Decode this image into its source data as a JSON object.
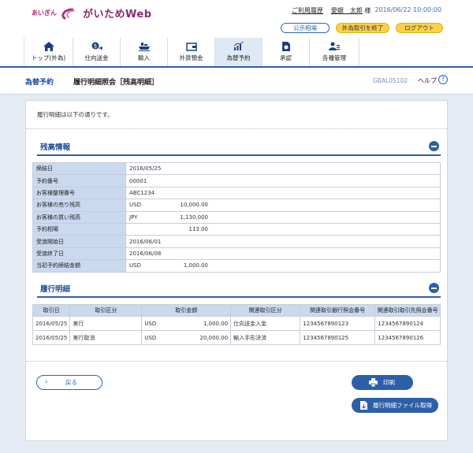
{
  "header": {
    "logo_small": "あいぎん",
    "logo_main": "がいためWeb",
    "history_link": "ご利用履歴",
    "user_name": "愛銀　太郎",
    "user_suffix": "様",
    "timestamp": "2016/06/22 10:00:00",
    "rates_button": "公示相場",
    "exit_fx_button": "外為取引を終了",
    "logout_button": "ログアウト"
  },
  "nav": [
    {
      "label": "トップ(外為)",
      "icon": "home-icon"
    },
    {
      "label": "仕向送金",
      "icon": "remittance-icon"
    },
    {
      "label": "輸入",
      "icon": "import-ship-icon"
    },
    {
      "label": "外貨預金",
      "icon": "deposit-icon"
    },
    {
      "label": "為替予約",
      "icon": "forward-contract-icon"
    },
    {
      "label": "承認",
      "icon": "approval-icon"
    },
    {
      "label": "各種管理",
      "icon": "management-icon"
    }
  ],
  "titlebar": {
    "section": "為替予約",
    "title": "履行明細照会［残高明細］",
    "screen_id": "GBAL05102",
    "help": "ヘルプ",
    "help_icon": "?"
  },
  "intro": "履行明細は以下の通りです。",
  "balance": {
    "heading": "残高情報",
    "rows": [
      {
        "label": "締結日",
        "value": "2016/05/25"
      },
      {
        "label": "予約番号",
        "value": "00001"
      },
      {
        "label": "お客様整理番号",
        "value": "ABC1234"
      },
      {
        "label": "お客様の売り残高",
        "currency": "USD",
        "amount": "10,000.00"
      },
      {
        "label": "お客様の買い残高",
        "currency": "JPY",
        "amount": "1,130,000"
      },
      {
        "label": "予約相場",
        "amount": "113.00"
      },
      {
        "label": "受渡開始日",
        "value": "2016/06/01"
      },
      {
        "label": "受渡終了日",
        "value": "2016/06/08"
      },
      {
        "label": "当初予約締結金額",
        "currency": "USD",
        "amount": "1,000.00"
      }
    ]
  },
  "details": {
    "heading": "履行明細",
    "columns": [
      "取引日",
      "取引区分",
      "取引金額",
      "関連取引区分",
      "関連取引銀行照会番号",
      "関連取引取引先照会番号"
    ],
    "rows": [
      {
        "date": "2016/05/25",
        "type": "実行",
        "currency": "USD",
        "amount": "1,000.00",
        "related_type": "仕向送金入金",
        "bank_ref": "1234567890123",
        "client_ref": "1234567890124"
      },
      {
        "date": "2016/05/25",
        "type": "実行取消",
        "currency": "USD",
        "amount": "20,000.00",
        "related_type": "輸入手形決済",
        "bank_ref": "1234567890125",
        "client_ref": "1234567890126"
      }
    ]
  },
  "buttons": {
    "back": "戻る",
    "print": "印刷",
    "download": "履行明細ファイル取得"
  }
}
